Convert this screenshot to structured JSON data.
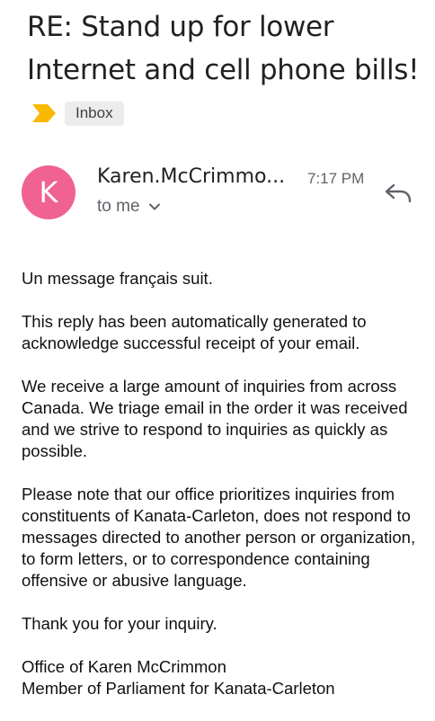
{
  "email": {
    "subject_lines": [
      "RE: Stand up for lower",
      "Internet and cell phone bills!"
    ],
    "label": "Inbox",
    "avatar_letter": "K",
    "sender": "Karen.McCrimmo...",
    "time": "7:17 PM",
    "recipient": "to me",
    "body": [
      [
        "Un message français suit."
      ],
      [
        "This reply has been automatically generated to",
        "acknowledge successful receipt of your email."
      ],
      [
        "We receive a large amount of inquiries from across",
        "Canada. We triage email in the order it was received",
        "and we strive to respond to inquiries as quickly as",
        "possible."
      ],
      [
        "Please note that our office prioritizes inquiries from",
        "constituents of Kanata-Carleton, does not respond to",
        "messages directed to another person or organization,",
        "to form letters, or to correspondence containing",
        "offensive or abusive language."
      ],
      [
        "Thank you for your inquiry."
      ],
      [
        "Office of Karen McCrimmon",
        "Member of Parliament for Kanata-Carleton"
      ]
    ]
  },
  "colors": {
    "avatar": "#f06292",
    "importance": "#f9b900"
  },
  "icons": {
    "importance": "importance-marker-icon",
    "reply": "reply-arrow-icon",
    "expand": "chevron-down-icon"
  }
}
